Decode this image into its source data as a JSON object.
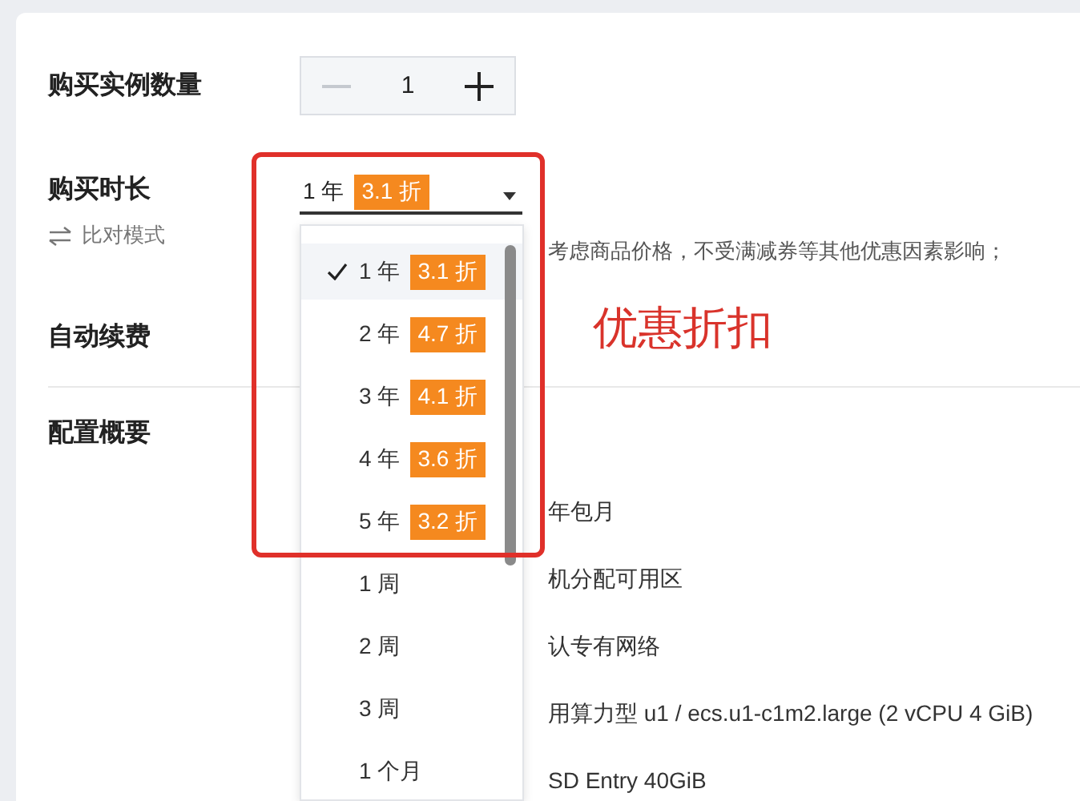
{
  "quantity": {
    "label": "购买实例数量",
    "value": "1",
    "decrement_disabled": true
  },
  "duration": {
    "label": "购买时长",
    "compare_mode": "比对模式",
    "value": "1 年",
    "discount": "3.1 折",
    "options": [
      {
        "label": "1 年",
        "discount": "3.1 折",
        "selected": true
      },
      {
        "label": "2 年",
        "discount": "4.7 折",
        "selected": false
      },
      {
        "label": "3 年",
        "discount": "4.1 折",
        "selected": false
      },
      {
        "label": "4 年",
        "discount": "3.6 折",
        "selected": false
      },
      {
        "label": "5 年",
        "discount": "3.2 折",
        "selected": false
      },
      {
        "label": "1 周",
        "selected": false
      },
      {
        "label": "2 周",
        "selected": false
      },
      {
        "label": "3 周",
        "selected": false
      },
      {
        "label": "1 个月",
        "selected": false
      }
    ]
  },
  "note": "考虑商品价格，不受满减券等其他优惠因素影响；",
  "auto_renew": {
    "label": "自动续费"
  },
  "config_summary": {
    "label": "配置概要",
    "lines": [
      "年包月",
      "机分配可用区",
      "认专有网络",
      "用算力型 u1 / ecs.u1-c1m2.large (2 vCPU 4 GiB)",
      "SD Entry 40GiB"
    ]
  },
  "annotation": {
    "text": "优惠折扣"
  }
}
